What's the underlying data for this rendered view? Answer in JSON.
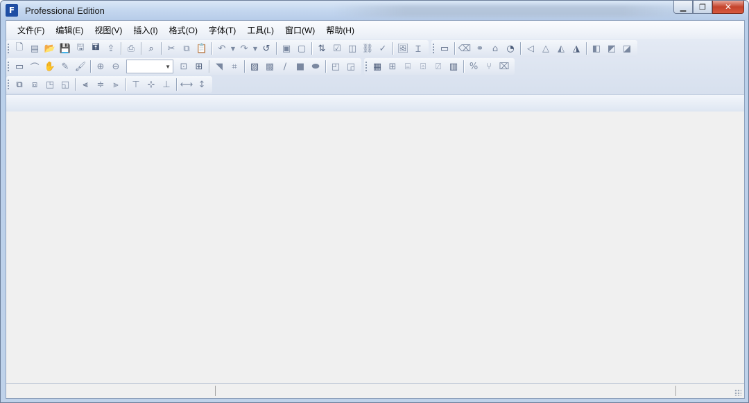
{
  "window": {
    "title": "Professional Edition",
    "app_icon_glyph": "F",
    "buttons": {
      "minimize": "▁",
      "restore": "❐",
      "close": "✕"
    }
  },
  "menu": [
    "文件(F)",
    "编辑(E)",
    "视图(V)",
    "插入(I)",
    "格式(O)",
    "字体(T)",
    "工具(L)",
    "窗口(W)",
    "帮助(H)"
  ],
  "toolbar": {
    "zoom_value": "",
    "row1_group1": [
      {
        "name": "new-icon",
        "glyph": "🗋"
      },
      {
        "name": "template-icon",
        "glyph": "▤"
      },
      {
        "name": "open-icon",
        "glyph": "📂"
      },
      {
        "name": "save-icon",
        "glyph": "💾"
      },
      {
        "name": "save-all-icon",
        "glyph": "🖫"
      },
      {
        "name": "save-as-icon",
        "glyph": "🖬"
      },
      {
        "name": "export-icon",
        "glyph": "⇪"
      },
      {
        "sep": true
      },
      {
        "name": "print-icon",
        "glyph": "⎙"
      },
      {
        "sep": true
      },
      {
        "name": "find-icon",
        "glyph": "⌕"
      },
      {
        "sep": true
      },
      {
        "name": "cut-icon",
        "glyph": "✂"
      },
      {
        "name": "copy-icon",
        "glyph": "⧉"
      },
      {
        "name": "paste-icon",
        "glyph": "📋"
      },
      {
        "sep": true
      },
      {
        "name": "undo-icon",
        "glyph": "↶"
      },
      {
        "arrow": true
      },
      {
        "name": "redo-icon",
        "glyph": "↷"
      },
      {
        "arrow": true
      },
      {
        "name": "refresh-icon",
        "glyph": "↺"
      },
      {
        "sep": true
      },
      {
        "name": "page-setup-icon",
        "glyph": "▣"
      },
      {
        "name": "page-prop-icon",
        "glyph": "▢"
      },
      {
        "sep": true
      },
      {
        "name": "sort-icon",
        "glyph": "⇅"
      },
      {
        "name": "checkbox-icon",
        "glyph": "☑"
      },
      {
        "name": "textbox-icon",
        "glyph": "◫"
      },
      {
        "name": "link-icon",
        "glyph": "⛓"
      },
      {
        "name": "check-icon",
        "glyph": "✓"
      },
      {
        "sep": true
      },
      {
        "name": "picture-icon",
        "glyph": "🖼"
      },
      {
        "name": "text-cursor-icon",
        "glyph": "Ɪ"
      }
    ],
    "row1_group2": [
      {
        "name": "form-icon",
        "glyph": "▭"
      },
      {
        "sep": true
      },
      {
        "name": "eraser-icon",
        "glyph": "⌫"
      },
      {
        "name": "binoculars-icon",
        "glyph": "⚭"
      },
      {
        "name": "stamp-icon",
        "glyph": "⌂"
      },
      {
        "name": "clock-icon",
        "glyph": "◔"
      },
      {
        "sep": true
      },
      {
        "name": "align-shape-1-icon",
        "glyph": "◁"
      },
      {
        "name": "align-shape-2-icon",
        "glyph": "△"
      },
      {
        "name": "align-shape-3-icon",
        "glyph": "◭"
      },
      {
        "name": "align-shape-4-icon",
        "glyph": "◮"
      },
      {
        "sep": true
      },
      {
        "name": "layer-1-icon",
        "glyph": "◧"
      },
      {
        "name": "layer-2-icon",
        "glyph": "◩"
      },
      {
        "name": "layer-3-icon",
        "glyph": "◪"
      }
    ],
    "row2_group1": [
      {
        "name": "select-icon",
        "glyph": "▭"
      },
      {
        "name": "lasso-icon",
        "glyph": "⌒"
      },
      {
        "name": "hand-icon",
        "glyph": "✋"
      },
      {
        "name": "pen-icon",
        "glyph": "✎"
      },
      {
        "name": "brush-icon",
        "glyph": "🖌"
      },
      {
        "sep": true
      },
      {
        "name": "zoom-in-icon",
        "glyph": "⊕"
      },
      {
        "name": "zoom-out-icon",
        "glyph": "⊖"
      },
      {
        "zoom": true
      },
      {
        "name": "fit-icon",
        "glyph": "⊡"
      },
      {
        "name": "grid-select-icon",
        "glyph": "⊞"
      },
      {
        "sep": true
      },
      {
        "name": "pointer-icon",
        "glyph": "◥"
      },
      {
        "name": "crop-icon",
        "glyph": "⌗"
      },
      {
        "sep": true
      },
      {
        "name": "image-icon",
        "glyph": "▨"
      },
      {
        "name": "chart-icon",
        "glyph": "▩"
      },
      {
        "name": "line-icon",
        "glyph": "∕"
      },
      {
        "name": "rect-icon",
        "glyph": "■"
      },
      {
        "name": "ellipse-icon",
        "glyph": "⬬"
      },
      {
        "sep": true
      },
      {
        "name": "frame-1-icon",
        "glyph": "◰"
      },
      {
        "name": "frame-2-icon",
        "glyph": "◲"
      }
    ],
    "row2_group2": [
      {
        "name": "table-icon",
        "glyph": "▦"
      },
      {
        "name": "table-insert-icon",
        "glyph": "⊞"
      },
      {
        "name": "table-cells-icon",
        "glyph": "⌸"
      },
      {
        "name": "table-border-icon",
        "glyph": "⌹"
      },
      {
        "name": "table-split-icon",
        "glyph": "⍁"
      },
      {
        "name": "table-merge-icon",
        "glyph": "▥"
      },
      {
        "sep": true
      },
      {
        "name": "percent-icon",
        "glyph": "%"
      },
      {
        "name": "tree-icon",
        "glyph": "⑂"
      },
      {
        "name": "no-ok-icon",
        "glyph": "⌧"
      }
    ],
    "row3_group1": [
      {
        "name": "bring-front-icon",
        "glyph": "⧉"
      },
      {
        "name": "send-back-icon",
        "glyph": "⧈"
      },
      {
        "name": "forward-icon",
        "glyph": "◳"
      },
      {
        "name": "backward-icon",
        "glyph": "◱"
      },
      {
        "sep": true
      },
      {
        "name": "align-left-icon",
        "glyph": "⫷"
      },
      {
        "name": "align-center-icon",
        "glyph": "≑"
      },
      {
        "name": "align-right-icon",
        "glyph": "⫸"
      },
      {
        "sep": true
      },
      {
        "name": "align-top-icon",
        "glyph": "⊤"
      },
      {
        "name": "align-middle-icon",
        "glyph": "⊹"
      },
      {
        "name": "align-bottom-icon",
        "glyph": "⊥"
      },
      {
        "sep": true
      },
      {
        "name": "distribute-h-icon",
        "glyph": "⟷"
      },
      {
        "name": "distribute-v-icon",
        "glyph": "↕"
      }
    ]
  }
}
